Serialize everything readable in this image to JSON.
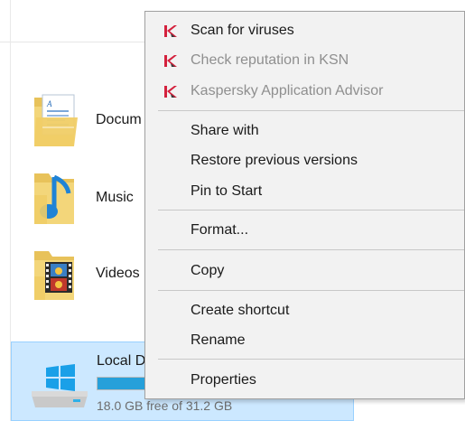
{
  "explorer": {
    "folders": [
      {
        "label": "Docum",
        "icon": "documents-folder-icon"
      },
      {
        "label": "Music",
        "icon": "music-folder-icon"
      },
      {
        "label": "Videos",
        "icon": "videos-folder-icon"
      }
    ],
    "drive": {
      "name": "Local D",
      "free_text": "18.0 GB free of 31.2 GB",
      "used_fraction": 0.42,
      "icon": "windows-drive-icon"
    }
  },
  "context_menu": {
    "items": [
      {
        "label": "Scan for viruses",
        "icon": "kaspersky-icon",
        "enabled": true
      },
      {
        "label": "Check reputation in KSN",
        "icon": "kaspersky-icon",
        "enabled": false
      },
      {
        "label": "Kaspersky Application Advisor",
        "icon": "kaspersky-icon",
        "enabled": false
      },
      {
        "label": "Share with",
        "enabled": true
      },
      {
        "label": "Restore previous versions",
        "enabled": true
      },
      {
        "label": "Pin to Start",
        "enabled": true
      },
      {
        "label": "Format...",
        "enabled": true
      },
      {
        "label": "Copy",
        "enabled": true
      },
      {
        "label": "Create shortcut",
        "enabled": true
      },
      {
        "label": "Rename",
        "enabled": true
      },
      {
        "label": "Properties",
        "enabled": true
      }
    ]
  },
  "colors": {
    "selection_bg": "#cce8ff",
    "menu_bg": "#f2f2f2",
    "progress": "#26a0da",
    "kaspersky_red": "#d4213d"
  }
}
